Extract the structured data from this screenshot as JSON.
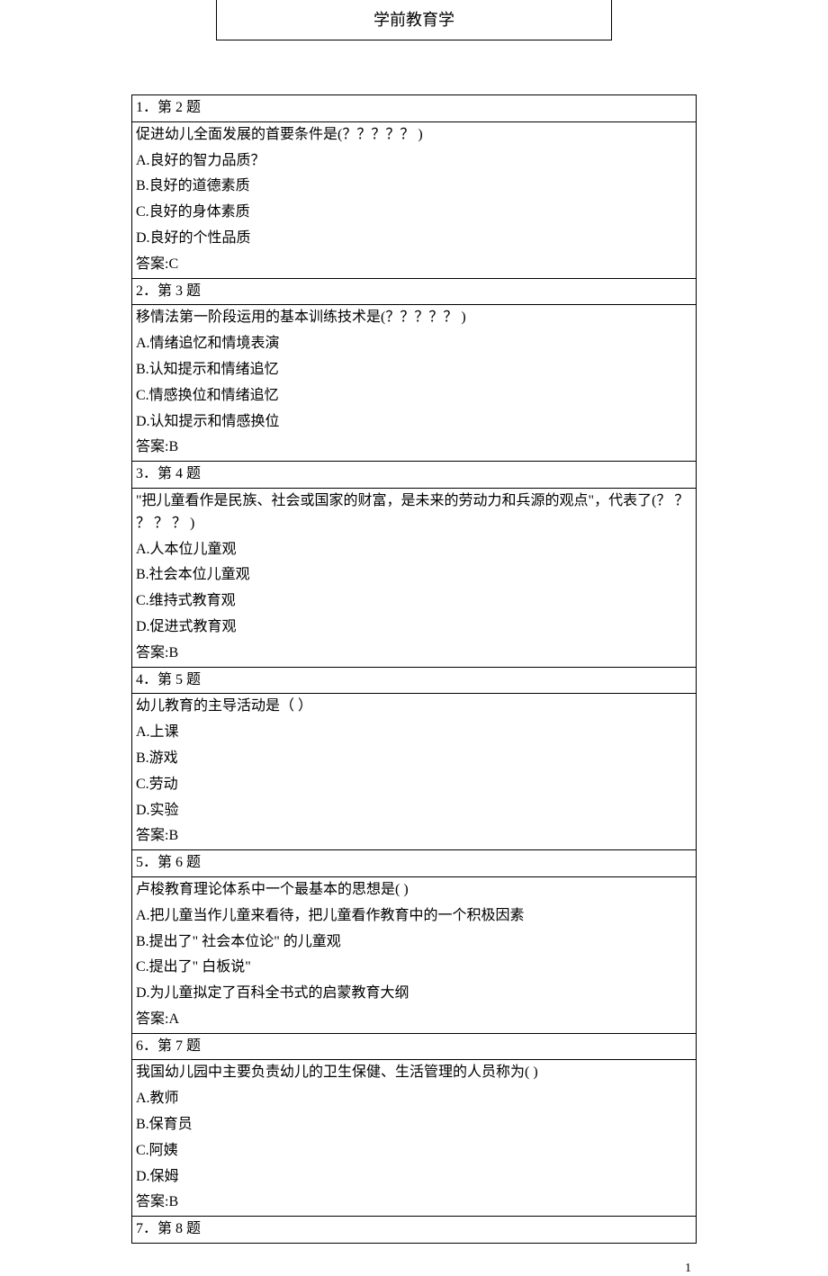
{
  "title": "学前教育学",
  "questions": [
    {
      "header": "1．第 2 题",
      "prompt": "促进幼儿全面发展的首要条件是(？？？？？ )",
      "options": [
        "A.良好的智力品质？",
        "B.良好的道德素质",
        "C.良好的身体素质",
        "D.良好的个性品质"
      ],
      "answer": "答案:C"
    },
    {
      "header": "2．第 3 题",
      "prompt": "移情法第一阶段运用的基本训练技术是(？？？？？ )",
      "options": [
        "A.情绪追忆和情境表演",
        "B.认知提示和情绪追忆",
        "C.情感换位和情绪追忆",
        "D.认知提示和情感换位"
      ],
      "answer": "答案:B"
    },
    {
      "header": "3．第 4 题",
      "prompt": "\"把儿童看作是民族、社会或国家的财富，是未来的劳动力和兵源的观点\"，代表了(？ ？ ？ ？ ？  )",
      "options": [
        "A.人本位儿童观",
        "B.社会本位儿童观",
        "C.维持式教育观",
        "D.促进式教育观"
      ],
      "answer": "答案:B"
    },
    {
      "header": "4．第 5 题",
      "prompt": "幼儿教育的主导活动是（ ）",
      "options": [
        "A.上课",
        "B.游戏",
        "C.劳动",
        "D.实验"
      ],
      "answer": "答案:B"
    },
    {
      "header": "5．第 6 题",
      "prompt": "卢梭教育理论体系中一个最基本的思想是( )",
      "options": [
        "A.把儿童当作儿童来看待，把儿童看作教育中的一个积极因素",
        "B.提出了\" 社会本位论\" 的儿童观",
        "C.提出了\" 白板说\"",
        "D.为儿童拟定了百科全书式的启蒙教育大纲"
      ],
      "answer": "答案:A"
    },
    {
      "header": "6．第 7 题",
      "prompt": "我国幼儿园中主要负责幼儿的卫生保健、生活管理的人员称为( )",
      "options": [
        "A.教师",
        "B.保育员",
        "C.阿姨",
        "D.保姆"
      ],
      "answer": "答案:B"
    },
    {
      "header": "7．第 8 题",
      "prompt": "",
      "options": [],
      "answer": ""
    }
  ],
  "page_number": "1"
}
